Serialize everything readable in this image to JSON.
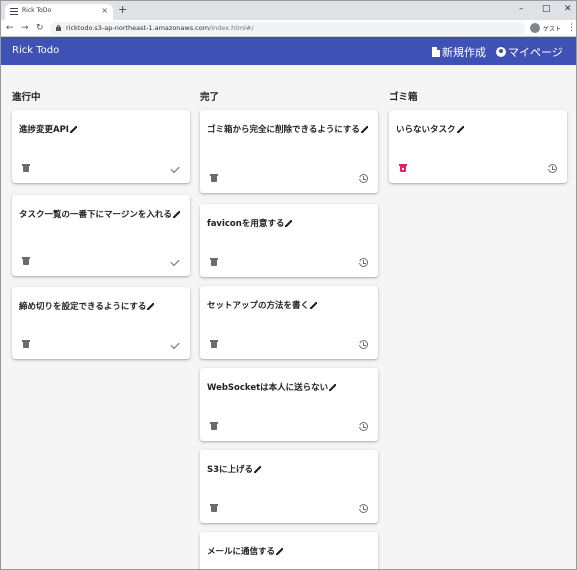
{
  "browser": {
    "tab_title": "Rick ToDo",
    "url_host": "ricktodo.s3-ap-northeast-1.amazonaws.com",
    "url_path": "/index.html#/",
    "profile_label": "ゲスト"
  },
  "appbar": {
    "title": "Rick Todo",
    "new_label": "新規作成",
    "mypage_label": "マイページ"
  },
  "columns": {
    "in_progress": {
      "title": "進行中",
      "cards": [
        {
          "title": "進捗変更API"
        },
        {
          "title": "タスク一覧の一番下にマージンを入れる"
        },
        {
          "title": "締め切りを設定できるようにする"
        }
      ]
    },
    "done": {
      "title": "完了",
      "cards": [
        {
          "title": "ゴミ箱から完全に削除できるようにする"
        },
        {
          "title": "faviconを用意する"
        },
        {
          "title": "セットアップの方法を書く"
        },
        {
          "title": "WebSocketは本人に送らない"
        },
        {
          "title": "S3に上げる"
        },
        {
          "title": "メールに通信する"
        }
      ]
    },
    "trash": {
      "title": "ゴミ箱",
      "cards": [
        {
          "title": "いらないタスク"
        }
      ]
    }
  },
  "colors": {
    "appbar": "#3f51b5",
    "delete_accent": "#e91e63"
  }
}
